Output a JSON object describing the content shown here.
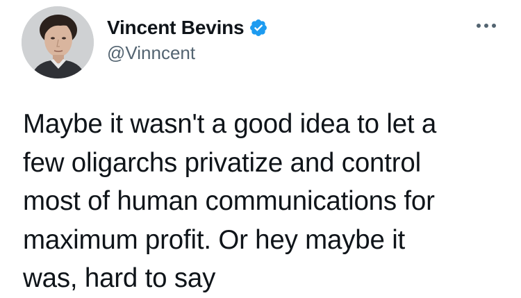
{
  "author": {
    "display_name": "Vincent Bevins",
    "handle": "@Vinncent",
    "verified": true,
    "avatar_icon": "profile-photo",
    "verified_icon": "verified-badge-icon"
  },
  "menu": {
    "icon": "more-horizontal-icon"
  },
  "tweet": {
    "text": "Maybe it wasn't a good idea to let a\nfew oligarchs privatize and control\nmost of human communications for\nmaximum profit. Or hey maybe it\nwas, hard to say"
  },
  "colors": {
    "verified": "#1d9bf0",
    "text": "#0f1419",
    "secondary": "#536471",
    "background": "#ffffff"
  }
}
